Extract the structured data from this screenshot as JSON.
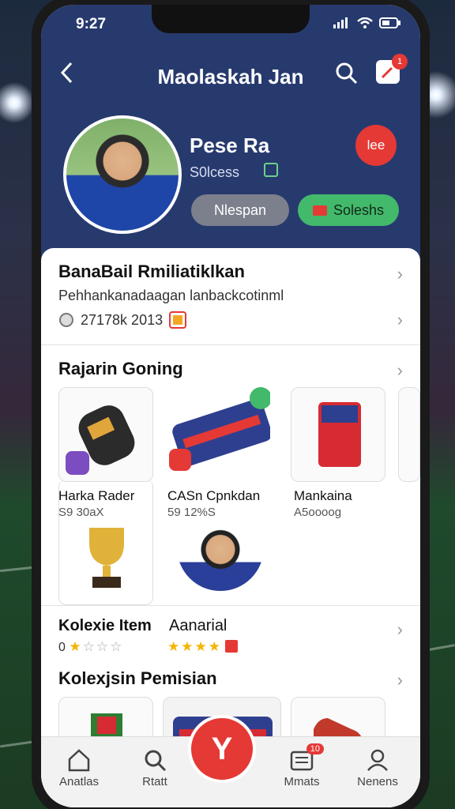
{
  "status": {
    "time": "9:27"
  },
  "header": {
    "title": "Maolaskah Jan",
    "notification_count": "1"
  },
  "profile": {
    "name": "Pese Ra",
    "subtitle": "S0lcess",
    "badge": "lee",
    "buttons": {
      "message": "Nlespan",
      "subscribe": "Soleshs"
    }
  },
  "section1": {
    "title": "BanaBail Rmiliatiklkan",
    "description": "Pehhankanadaagan lanbackcotinml",
    "stats": "27178k 2013"
  },
  "section2": {
    "title": "Rajarin Goning",
    "items": [
      {
        "name": "Harka Rader",
        "sub": "S9 30aX"
      },
      {
        "name": "CASn Cpnkdan",
        "sub": "59 12%S"
      },
      {
        "name": "Mankaina",
        "sub": "A5oooog"
      }
    ]
  },
  "section3": {
    "title": "Kolexie Item",
    "rating_label": "0",
    "right_title": "Aanarial"
  },
  "section4": {
    "title": "Kolexjsin Pemisian"
  },
  "bottom_nav": {
    "items": [
      "Anatlas",
      "Rtatt",
      "Mmats",
      "Nenens"
    ],
    "badge": "10",
    "fab_icon": "Y"
  },
  "colors": {
    "accent": "#e53935",
    "header_bg": "#273a6e",
    "success": "#43b96b"
  }
}
